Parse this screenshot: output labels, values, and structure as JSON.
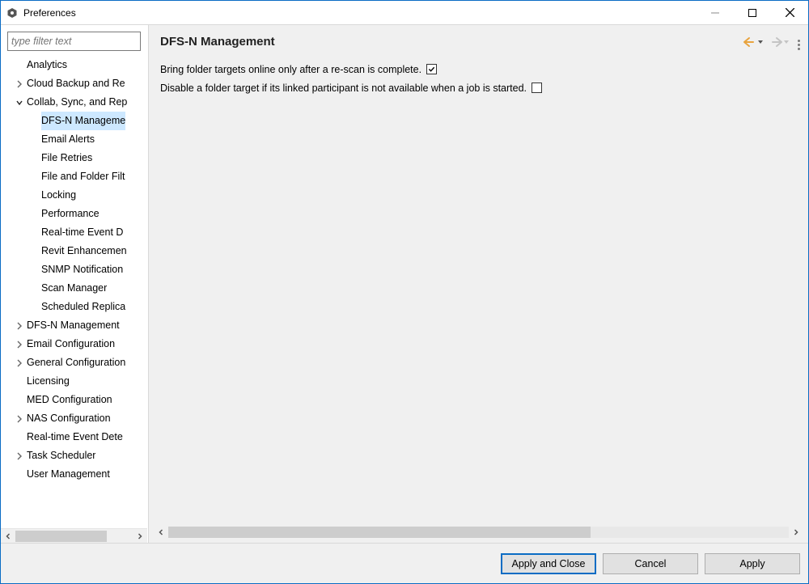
{
  "window": {
    "title": "Preferences"
  },
  "filter": {
    "placeholder": "type filter text"
  },
  "tree": [
    {
      "label": "Analytics",
      "indent": 0,
      "expand": ""
    },
    {
      "label": "Cloud Backup and Re",
      "indent": 0,
      "expand": "closed"
    },
    {
      "label": "Collab, Sync, and Rep",
      "indent": 0,
      "expand": "open"
    },
    {
      "label": "DFS-N Manageme",
      "indent": 1,
      "expand": "",
      "selected": true
    },
    {
      "label": "Email Alerts",
      "indent": 1,
      "expand": ""
    },
    {
      "label": "File Retries",
      "indent": 1,
      "expand": ""
    },
    {
      "label": "File and Folder Filt",
      "indent": 1,
      "expand": ""
    },
    {
      "label": "Locking",
      "indent": 1,
      "expand": ""
    },
    {
      "label": "Performance",
      "indent": 1,
      "expand": ""
    },
    {
      "label": "Real-time Event D",
      "indent": 1,
      "expand": ""
    },
    {
      "label": "Revit Enhancemen",
      "indent": 1,
      "expand": ""
    },
    {
      "label": "SNMP Notification",
      "indent": 1,
      "expand": ""
    },
    {
      "label": "Scan Manager",
      "indent": 1,
      "expand": ""
    },
    {
      "label": "Scheduled Replica",
      "indent": 1,
      "expand": ""
    },
    {
      "label": "DFS-N Management",
      "indent": 0,
      "expand": "closed"
    },
    {
      "label": "Email Configuration",
      "indent": 0,
      "expand": "closed"
    },
    {
      "label": "General Configuration",
      "indent": 0,
      "expand": "closed"
    },
    {
      "label": "Licensing",
      "indent": 0,
      "expand": ""
    },
    {
      "label": "MED Configuration",
      "indent": 0,
      "expand": ""
    },
    {
      "label": "NAS Configuration",
      "indent": 0,
      "expand": "closed"
    },
    {
      "label": "Real-time Event Dete",
      "indent": 0,
      "expand": ""
    },
    {
      "label": "Task Scheduler",
      "indent": 0,
      "expand": "closed"
    },
    {
      "label": "User Management",
      "indent": 0,
      "expand": ""
    }
  ],
  "content": {
    "title": "DFS-N Management",
    "options": [
      {
        "text": "Bring folder targets online only after a re-scan is complete.",
        "checked": true
      },
      {
        "text": "Disable a folder target if its linked participant is not available when a job is started.",
        "checked": false
      }
    ]
  },
  "buttons": {
    "apply_close": "Apply and Close",
    "cancel": "Cancel",
    "apply": "Apply"
  },
  "colors": {
    "nav_back_active": "#e8a33d",
    "nav_fwd_inactive": "#b8b8b8"
  }
}
